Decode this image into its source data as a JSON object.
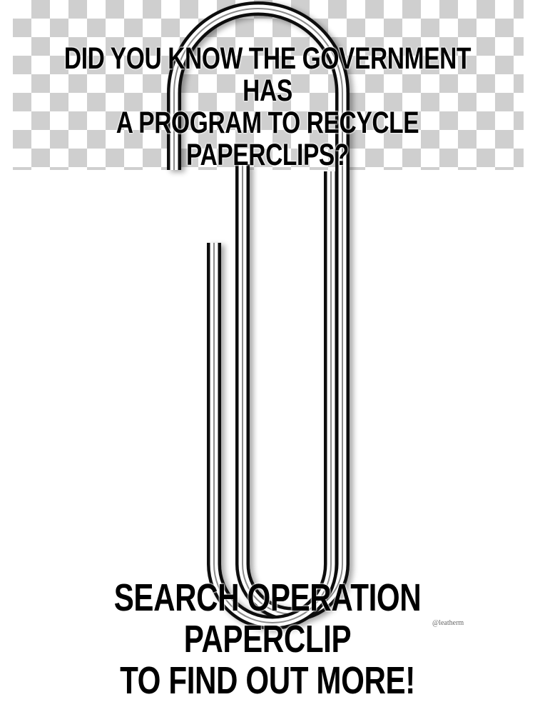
{
  "meme": {
    "top_text": [
      "DID YOU KNOW THE GOVERNMENT HAS",
      "A PROGRAM TO RECYCLE PAPERCLIPS?"
    ],
    "bottom_text": [
      "SEARCH OPERATION PAPERCLIP",
      "TO FIND OUT MORE!"
    ],
    "watermark": "@leatherm"
  },
  "colors": {
    "background": "#ffffff",
    "checker": "#cfcfcf",
    "text": "#000000",
    "wire": "#1a1a1a"
  },
  "image": "paperclip-icon"
}
